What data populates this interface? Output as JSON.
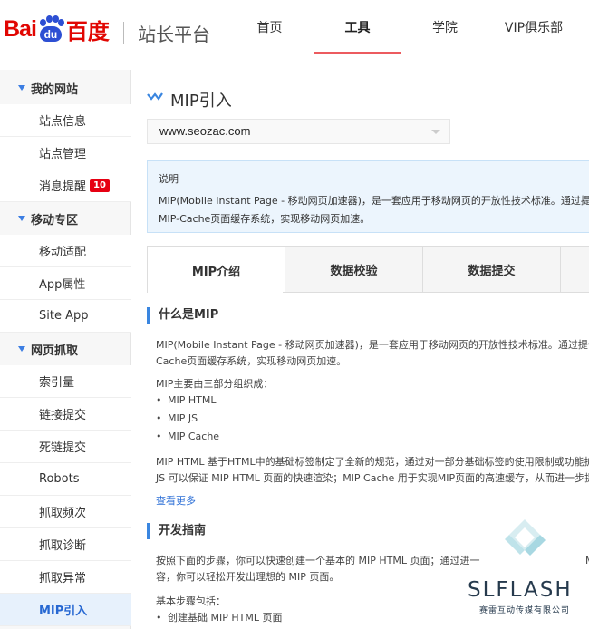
{
  "header": {
    "logo_text_bai": "Bai",
    "logo_paw_text": "du",
    "logo_text_cn": "百度",
    "site_title": "站长平台",
    "nav": [
      {
        "label": "首页"
      },
      {
        "label": "工具",
        "active": true
      },
      {
        "label": "学院"
      },
      {
        "label": "VIP俱乐部"
      }
    ]
  },
  "colors": {
    "brand_red": "#e10602",
    "brand_blue": "#2d4fd3",
    "accent_blue": "#3a86e0",
    "tab_underline": "#ec5b5f",
    "badge": "#e60012"
  },
  "sidebar": {
    "groups": [
      {
        "label": "我的网站",
        "items": [
          {
            "label": "站点信息"
          },
          {
            "label": "站点管理"
          },
          {
            "label": "消息提醒",
            "badge": "10"
          }
        ]
      },
      {
        "label": "移动专区",
        "items": [
          {
            "label": "移动适配"
          },
          {
            "label": "App属性"
          },
          {
            "label": "Site App"
          }
        ]
      },
      {
        "label": "网页抓取",
        "items": [
          {
            "label": "索引量"
          },
          {
            "label": "链接提交"
          },
          {
            "label": "死链提交"
          },
          {
            "label": "Robots"
          },
          {
            "label": "抓取频次"
          },
          {
            "label": "抓取诊断"
          },
          {
            "label": "抓取异常"
          },
          {
            "label": "MIP引入",
            "active": true
          }
        ]
      }
    ]
  },
  "main": {
    "title": "MIP引入",
    "site_select": "www.seozac.com",
    "note": {
      "label": "说明",
      "line1": "MIP(Mobile Instant Page - 移动网页加速器)，是一套应用于移动网页的开放性技术标准。通过提供MIP-",
      "line2": "MIP-Cache页面缓存系统，实现移动网页加速。"
    },
    "tabs": [
      {
        "label": "MIP介绍",
        "active": true
      },
      {
        "label": "数据校验"
      },
      {
        "label": "数据提交"
      }
    ],
    "section1": {
      "heading": "什么是MIP",
      "p1_line1": "MIP(Mobile Instant Page - 移动网页加速器)，是一套应用于移动网页的开放性技术标准。通过提供MIP-",
      "p1_line2": "Cache页面缓存系统，实现移动网页加速。",
      "p2": "MIP主要由三部分组织成：",
      "list": [
        "MIP HTML",
        "MIP JS",
        "MIP Cache"
      ],
      "p3_line1": "MIP HTML 基于HTML中的基础标签制定了全新的规范，通过对一部分基础标签的使用限制或功能扩展，",
      "p3_line2": "JS 可以保证 MIP HTML 页面的快速渲染；MIP Cache 用于实现MIP页面的高速缓存，从而进一步提高页",
      "more": "查看更多"
    },
    "section2": {
      "heading": "开发指南",
      "p1_line1": "按照下面的步骤，你可以快速创建一个基本的 MIP HTML 页面；通过进一",
      "p1_line1_tail": "M",
      "p1_line2": "容，你可以轻松开发出理想的 MIP 页面。",
      "p2": "基本步骤包括：",
      "list": [
        "创建基础 MIP HTML 页面"
      ]
    }
  },
  "watermark": {
    "text": "SLFLASH",
    "sub": "赛雷互动传媒有限公司"
  }
}
